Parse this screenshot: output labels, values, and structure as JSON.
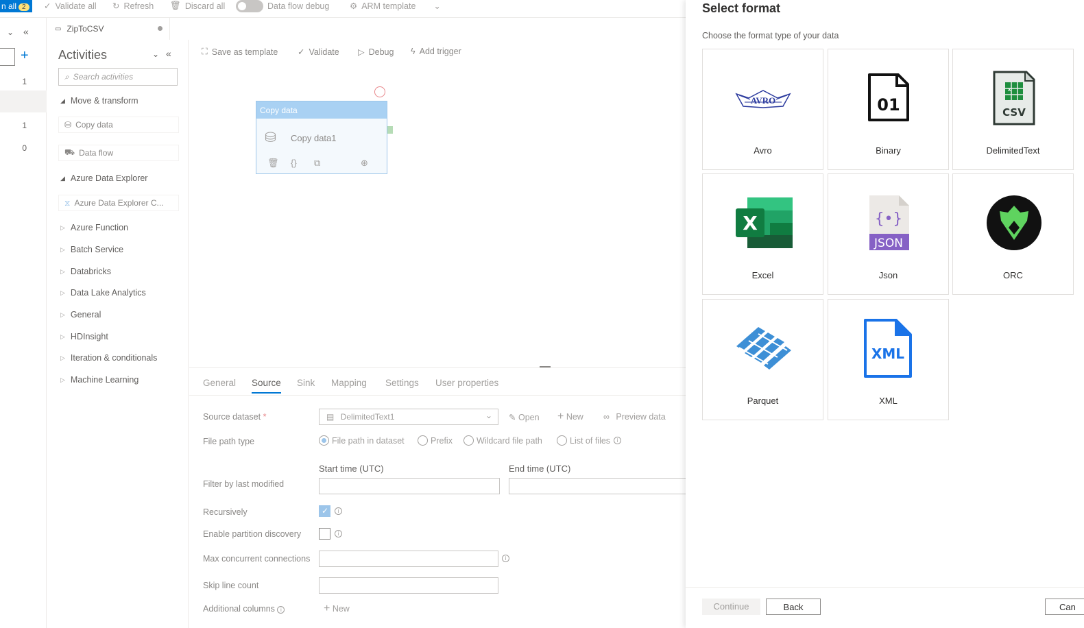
{
  "toolbar": {
    "publish_label": "n all",
    "publish_count": "2",
    "validate_all": "Validate all",
    "refresh": "Refresh",
    "discard_all": "Discard all",
    "data_flow_debug": "Data flow debug",
    "arm_template": "ARM template"
  },
  "rail": {
    "counts": [
      "1",
      "1",
      "0"
    ]
  },
  "tab": {
    "title": "ZipToCSV"
  },
  "activities": {
    "title": "Activities",
    "search_placeholder": "Search activities",
    "move_transform": "Move & transform",
    "copy_data": "Copy data",
    "data_flow": "Data flow",
    "azure_data_explorer": "Azure Data Explorer",
    "azure_data_explorer_cmd": "Azure Data Explorer C...",
    "groups": [
      "Azure Function",
      "Batch Service",
      "Databricks",
      "Data Lake Analytics",
      "General",
      "HDInsight",
      "Iteration & conditionals",
      "Machine Learning"
    ]
  },
  "canvas": {
    "save_as_template": "Save as template",
    "validate": "Validate",
    "debug": "Debug",
    "add_trigger": "Add trigger",
    "node_header": "Copy data",
    "node_name": "Copy data1"
  },
  "props": {
    "tabs": [
      "General",
      "Source",
      "Sink",
      "Mapping",
      "Settings",
      "User properties"
    ],
    "source_dataset_label": "Source dataset",
    "source_dataset_value": "DelimitedText1",
    "open": "Open",
    "new": "New",
    "preview_data": "Preview data",
    "file_path_type_label": "File path type",
    "file_path_options": [
      "File path in dataset",
      "Prefix",
      "Wildcard file path",
      "List of files"
    ],
    "start_time": "Start time (UTC)",
    "end_time": "End time (UTC)",
    "filter_label": "Filter by last modified",
    "recursively": "Recursively",
    "partition_discovery": "Enable partition discovery",
    "max_conn": "Max concurrent connections",
    "skip_line": "Skip line count",
    "additional_columns": "Additional columns",
    "new_btn": "New"
  },
  "flyout": {
    "title": "Select format",
    "subtitle": "Choose the format type of your data",
    "formats": [
      "Avro",
      "Binary",
      "DelimitedText",
      "Excel",
      "Json",
      "ORC",
      "Parquet",
      "XML"
    ],
    "icon_text": {
      "avro": "AVRO",
      "binary": "01",
      "csv": "CSV",
      "excel": "X",
      "json": "JSON",
      "xml": "XML"
    },
    "continue": "Continue",
    "back": "Back",
    "cancel": "Can"
  },
  "colors": {
    "accent": "#0078d4",
    "excel_green": "#107c41",
    "json_purple": "#8661c5",
    "orc_green": "#5fd35f",
    "xml_blue": "#1a73e8"
  }
}
